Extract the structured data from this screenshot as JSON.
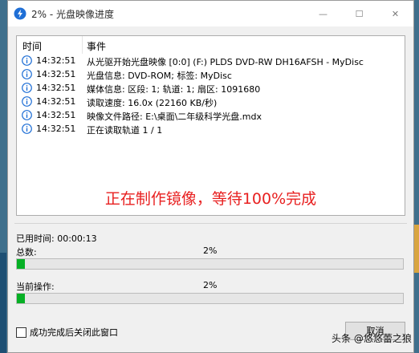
{
  "window": {
    "title": "2% - 光盘映像进度",
    "controls": {
      "minimize": "—",
      "maximize": "☐",
      "close": "✕"
    }
  },
  "log": {
    "columns": {
      "time": "时间",
      "event": "事件"
    },
    "rows": [
      {
        "icon": "info-icon",
        "time": "14:32:51",
        "message": "从光驱开始光盘映像 [0:0] (F:) PLDS DVD-RW DH16AFSH - MyDisc"
      },
      {
        "icon": "info-icon",
        "time": "14:32:51",
        "message": "光盘信息: DVD-ROM; 标签: MyDisc"
      },
      {
        "icon": "info-icon",
        "time": "14:32:51",
        "message": "媒体信息: 区段: 1; 轨道: 1; 扇区: 1091680"
      },
      {
        "icon": "info-icon",
        "time": "14:32:51",
        "message": "读取速度: 16.0x (22160 KB/秒)"
      },
      {
        "icon": "info-icon",
        "time": "14:32:51",
        "message": "映像文件路径: E:\\桌面\\二年级科学光盘.mdx"
      },
      {
        "icon": "info-icon",
        "time": "14:32:51",
        "message": "正在读取轨道 1 / 1"
      }
    ]
  },
  "annotation": {
    "text": "正在制作镜像，等待100%完成",
    "color": "#e82020"
  },
  "status": {
    "elapsed_label": "已用时间: 00:00:13",
    "total_label": "总数:",
    "total_percent_text": "2%",
    "total_progress": 0.02,
    "current_label": "当前操作:",
    "current_percent_text": "2%",
    "current_progress": 0.02
  },
  "footer": {
    "checkbox_label": "成功完成后关闭此窗口",
    "checkbox_checked": false,
    "cancel_label": "取消"
  },
  "watermark": "头条 @悠悠蕾之狼",
  "colors": {
    "progress": "#06b025",
    "accent": "#1f6fd6"
  }
}
